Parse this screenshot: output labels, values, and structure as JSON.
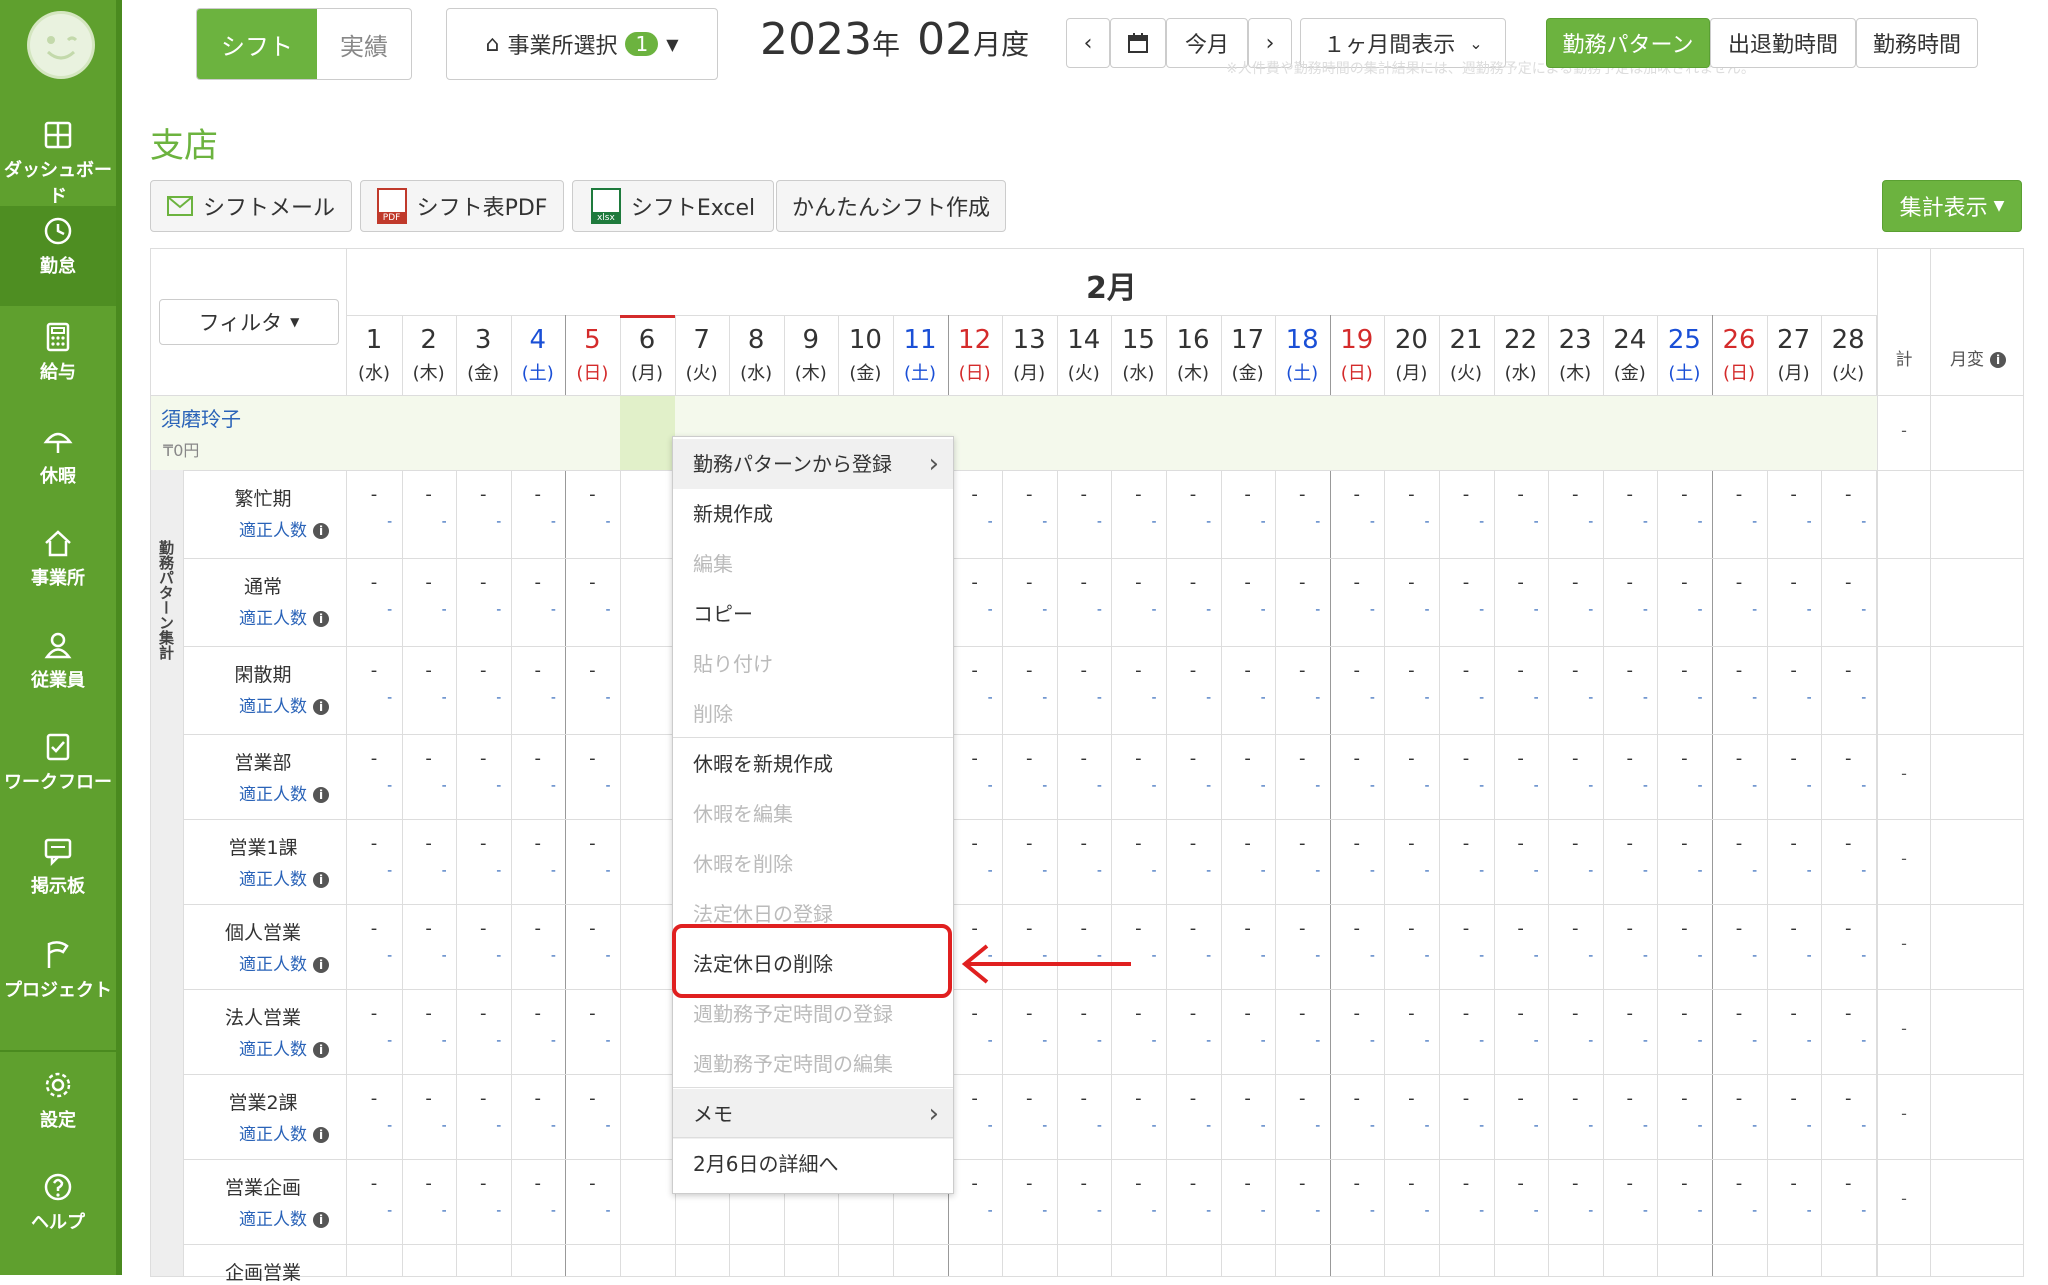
{
  "sidebar": {
    "items": [
      {
        "label": "ダッシュボード",
        "icon": "dashboard-icon"
      },
      {
        "label": "勤怠",
        "icon": "clock-icon",
        "active": true
      },
      {
        "label": "給与",
        "icon": "calculator-icon"
      },
      {
        "label": "休暇",
        "icon": "umbrella-icon"
      },
      {
        "label": "事業所",
        "icon": "home-icon"
      },
      {
        "label": "従業員",
        "icon": "user-icon"
      },
      {
        "label": "ワークフロー",
        "icon": "checklist-icon"
      },
      {
        "label": "掲示板",
        "icon": "message-icon"
      },
      {
        "label": "プロジェクト",
        "icon": "flag-icon"
      },
      {
        "label": "設定",
        "icon": "gear-icon"
      },
      {
        "label": "ヘルプ",
        "icon": "help-icon"
      }
    ]
  },
  "topbar": {
    "tab_shift": "シフト",
    "tab_actual": "実績",
    "office_select": "事業所選択",
    "office_count": "1",
    "year": "2023",
    "year_unit": "年",
    "month": "02",
    "month_unit": "月度",
    "today": "今月",
    "period": "１ヶ月間表示",
    "view_pattern": "勤務パターン",
    "view_inout": "出退勤時間",
    "view_worktime": "勤務時間",
    "notice": "※人件費や勤務時間の集計結果には、週勤務予定による勤務予定は加味されません。"
  },
  "page": {
    "title": "支店",
    "btn_mail": "シフトメール",
    "btn_pdf": "シフト表PDF",
    "btn_excel": "シフトExcel",
    "btn_easy": "かんたんシフト作成",
    "btn_summary": "集計表示",
    "pdf_badge": "PDF",
    "xlsx_badge": "xlsx"
  },
  "table": {
    "month_label": "2月",
    "filter": "フィルタ",
    "total_col": "計",
    "monthly_col": "月変",
    "days": [
      {
        "d": "1",
        "w": "(水)",
        "c": "blk"
      },
      {
        "d": "2",
        "w": "(木)",
        "c": "blk"
      },
      {
        "d": "3",
        "w": "(金)",
        "c": "blk"
      },
      {
        "d": "4",
        "w": "(土)",
        "c": "blue"
      },
      {
        "d": "5",
        "w": "(日)",
        "c": "red"
      },
      {
        "d": "6",
        "w": "(月)",
        "c": "blk"
      },
      {
        "d": "7",
        "w": "(火)",
        "c": "blk"
      },
      {
        "d": "8",
        "w": "(水)",
        "c": "blk"
      },
      {
        "d": "9",
        "w": "(木)",
        "c": "blk"
      },
      {
        "d": "10",
        "w": "(金)",
        "c": "blk"
      },
      {
        "d": "11",
        "w": "(土)",
        "c": "blue"
      },
      {
        "d": "12",
        "w": "(日)",
        "c": "red"
      },
      {
        "d": "13",
        "w": "(月)",
        "c": "blk"
      },
      {
        "d": "14",
        "w": "(火)",
        "c": "blk"
      },
      {
        "d": "15",
        "w": "(水)",
        "c": "blk"
      },
      {
        "d": "16",
        "w": "(木)",
        "c": "blk"
      },
      {
        "d": "17",
        "w": "(金)",
        "c": "blk"
      },
      {
        "d": "18",
        "w": "(土)",
        "c": "blue"
      },
      {
        "d": "19",
        "w": "(日)",
        "c": "red"
      },
      {
        "d": "20",
        "w": "(月)",
        "c": "blk"
      },
      {
        "d": "21",
        "w": "(火)",
        "c": "blk"
      },
      {
        "d": "22",
        "w": "(水)",
        "c": "blk"
      },
      {
        "d": "23",
        "w": "(木)",
        "c": "blk"
      },
      {
        "d": "24",
        "w": "(金)",
        "c": "blk"
      },
      {
        "d": "25",
        "w": "(土)",
        "c": "blue"
      },
      {
        "d": "26",
        "w": "(日)",
        "c": "red"
      },
      {
        "d": "27",
        "w": "(月)",
        "c": "blk"
      },
      {
        "d": "28",
        "w": "(火)",
        "c": "blk"
      }
    ],
    "employee": {
      "name": "須磨玲子",
      "cost": "0円",
      "yen": "₸",
      "total": "-"
    },
    "group_label": "勤務パターン集計",
    "rows": [
      {
        "label": "繁忙期",
        "sub": "適正人数"
      },
      {
        "label": "通常",
        "sub": "適正人数"
      },
      {
        "label": "閑散期",
        "sub": "適正人数"
      },
      {
        "label": "営業部",
        "sub": "適正人数"
      },
      {
        "label": "営業1課",
        "sub": "適正人数"
      },
      {
        "label": "個人営業",
        "sub": "適正人数"
      },
      {
        "label": "法人営業",
        "sub": "適正人数"
      },
      {
        "label": "営業2課",
        "sub": "適正人数"
      },
      {
        "label": "営業企画",
        "sub": "適正人数"
      },
      {
        "label": "企画営業",
        "sub": ""
      }
    ],
    "dash": "-"
  },
  "context_menu": {
    "items": [
      {
        "label": "勤務パターンから登録",
        "state": "enabled",
        "submenu": true
      },
      {
        "label": "新規作成",
        "state": "enabled"
      },
      {
        "label": "編集",
        "state": "disabled"
      },
      {
        "label": "コピー",
        "state": "enabled"
      },
      {
        "label": "貼り付け",
        "state": "disabled"
      },
      {
        "label": "削除",
        "state": "disabled"
      },
      {
        "label": "休暇を新規作成",
        "state": "enabled"
      },
      {
        "label": "休暇を編集",
        "state": "disabled"
      },
      {
        "label": "休暇を削除",
        "state": "disabled"
      },
      {
        "label": "法定休日の登録",
        "state": "disabled"
      },
      {
        "label": "法定休日の削除",
        "state": "enabled",
        "highlighted": true
      },
      {
        "label": "週勤務予定時間の登録",
        "state": "disabled"
      },
      {
        "label": "週勤務予定時間の編集",
        "state": "disabled"
      },
      {
        "label": "メモ",
        "state": "enabled",
        "submenu": true
      },
      {
        "label": "2月6日の詳細へ",
        "state": "enabled"
      }
    ]
  },
  "colors": {
    "brand": "#6cb33f",
    "sidebar": "#5fa02e",
    "highlight": "#e02020",
    "saturday": "#1a4fd6",
    "sunday": "#d42b2b"
  }
}
